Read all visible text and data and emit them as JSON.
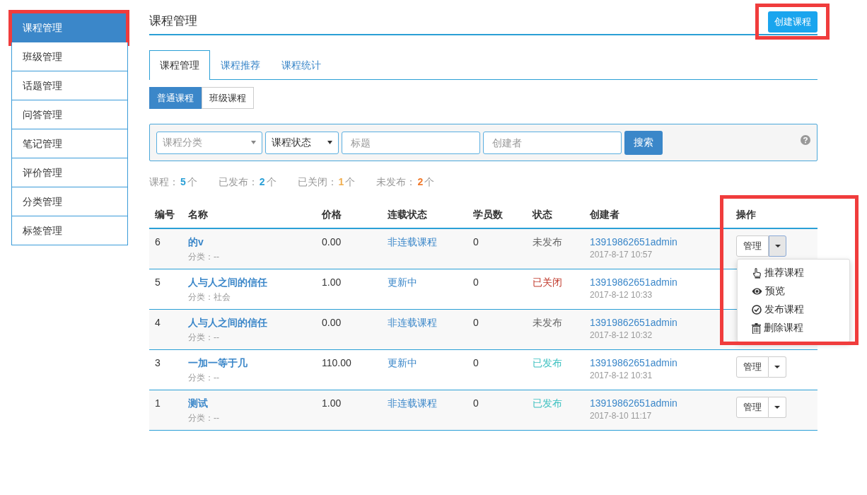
{
  "sidebar": {
    "items": [
      {
        "label": "课程管理",
        "selected": true,
        "highlighted": true
      },
      {
        "label": "班级管理",
        "selected": false,
        "highlighted": false
      },
      {
        "label": "话题管理",
        "selected": false,
        "highlighted": false
      },
      {
        "label": "问答管理",
        "selected": false,
        "highlighted": false
      },
      {
        "label": "笔记管理",
        "selected": false,
        "highlighted": false
      },
      {
        "label": "评价管理",
        "selected": false,
        "highlighted": false
      },
      {
        "label": "分类管理",
        "selected": false,
        "highlighted": false
      },
      {
        "label": "标签管理",
        "selected": false,
        "highlighted": false
      }
    ]
  },
  "page_title": "课程管理",
  "create_button": {
    "label": "创建课程",
    "highlighted": true
  },
  "tabs": [
    {
      "label": "课程管理",
      "selected": true
    },
    {
      "label": "课程推荐",
      "selected": false
    },
    {
      "label": "课程统计",
      "selected": false
    }
  ],
  "type_toggle": [
    {
      "label": "普通课程",
      "selected": true
    },
    {
      "label": "班级课程",
      "selected": false
    }
  ],
  "filters": {
    "category": {
      "placeholder": "课程分类"
    },
    "status": {
      "value": "课程状态"
    },
    "title": {
      "placeholder": "标题"
    },
    "creator": {
      "placeholder": "创建者"
    },
    "search_button": "搜索"
  },
  "stats": [
    {
      "label": "课程：",
      "count": "5",
      "unit": "个",
      "color": "#2a9fd6"
    },
    {
      "label": "已发布：",
      "count": "2",
      "unit": "个",
      "color": "#2a9fd6"
    },
    {
      "label": "已关闭：",
      "count": "1",
      "unit": "个",
      "color": "#f0ad4e"
    },
    {
      "label": "未发布：",
      "count": "2",
      "unit": "个",
      "color": "#f07a2c"
    }
  ],
  "table": {
    "columns": [
      "编号",
      "名称",
      "价格",
      "连载状态",
      "学员数",
      "状态",
      "创建者",
      "操作"
    ],
    "actions_highlighted": true,
    "rows": [
      {
        "id": "6",
        "name": "的v",
        "category": "分类：--",
        "price": "0.00",
        "serial": "非连载课程",
        "students": "0",
        "status": "未发布",
        "color": "#666666",
        "creator": "13919862651admin",
        "time": "2017-8-17 10:57",
        "manage": "管理",
        "expanded": true
      },
      {
        "id": "5",
        "name": "人与人之间的信任",
        "category": "分类：社会",
        "price": "1.00",
        "serial": "更新中",
        "students": "0",
        "status": "已关闭",
        "color": "#c0392b",
        "creator": "13919862651admin",
        "time": "2017-8-12 10:33"
      },
      {
        "id": "4",
        "name": "人与人之间的信任",
        "category": "分类：--",
        "price": "0.00",
        "serial": "非连载课程",
        "students": "0",
        "status": "未发布",
        "color": "#666666",
        "creator": "13919862651admin",
        "time": "2017-8-12 10:32"
      },
      {
        "id": "3",
        "name": "一加一等于几",
        "category": "分类：--",
        "price": "110.00",
        "serial": "更新中",
        "students": "0",
        "status": "已发布",
        "color": "#3cc0c0",
        "creator": "13919862651admin",
        "time": "2017-8-12 10:31",
        "manage": "管理",
        "expanded": false
      },
      {
        "id": "1",
        "name": "测试",
        "category": "分类：--",
        "price": "1.00",
        "serial": "非连载课程",
        "students": "0",
        "status": "已发布",
        "color": "#3cc0c0",
        "creator": "13919862651admin",
        "time": "2017-8-10 11:17",
        "manage": "管理",
        "expanded": false
      }
    ]
  },
  "dropdown": [
    {
      "label": "推荐课程",
      "kind": "hand"
    },
    {
      "label": "预览",
      "kind": "eye"
    },
    {
      "label": "发布课程",
      "kind": "check"
    },
    {
      "label": "删除课程",
      "kind": "trash"
    }
  ]
}
